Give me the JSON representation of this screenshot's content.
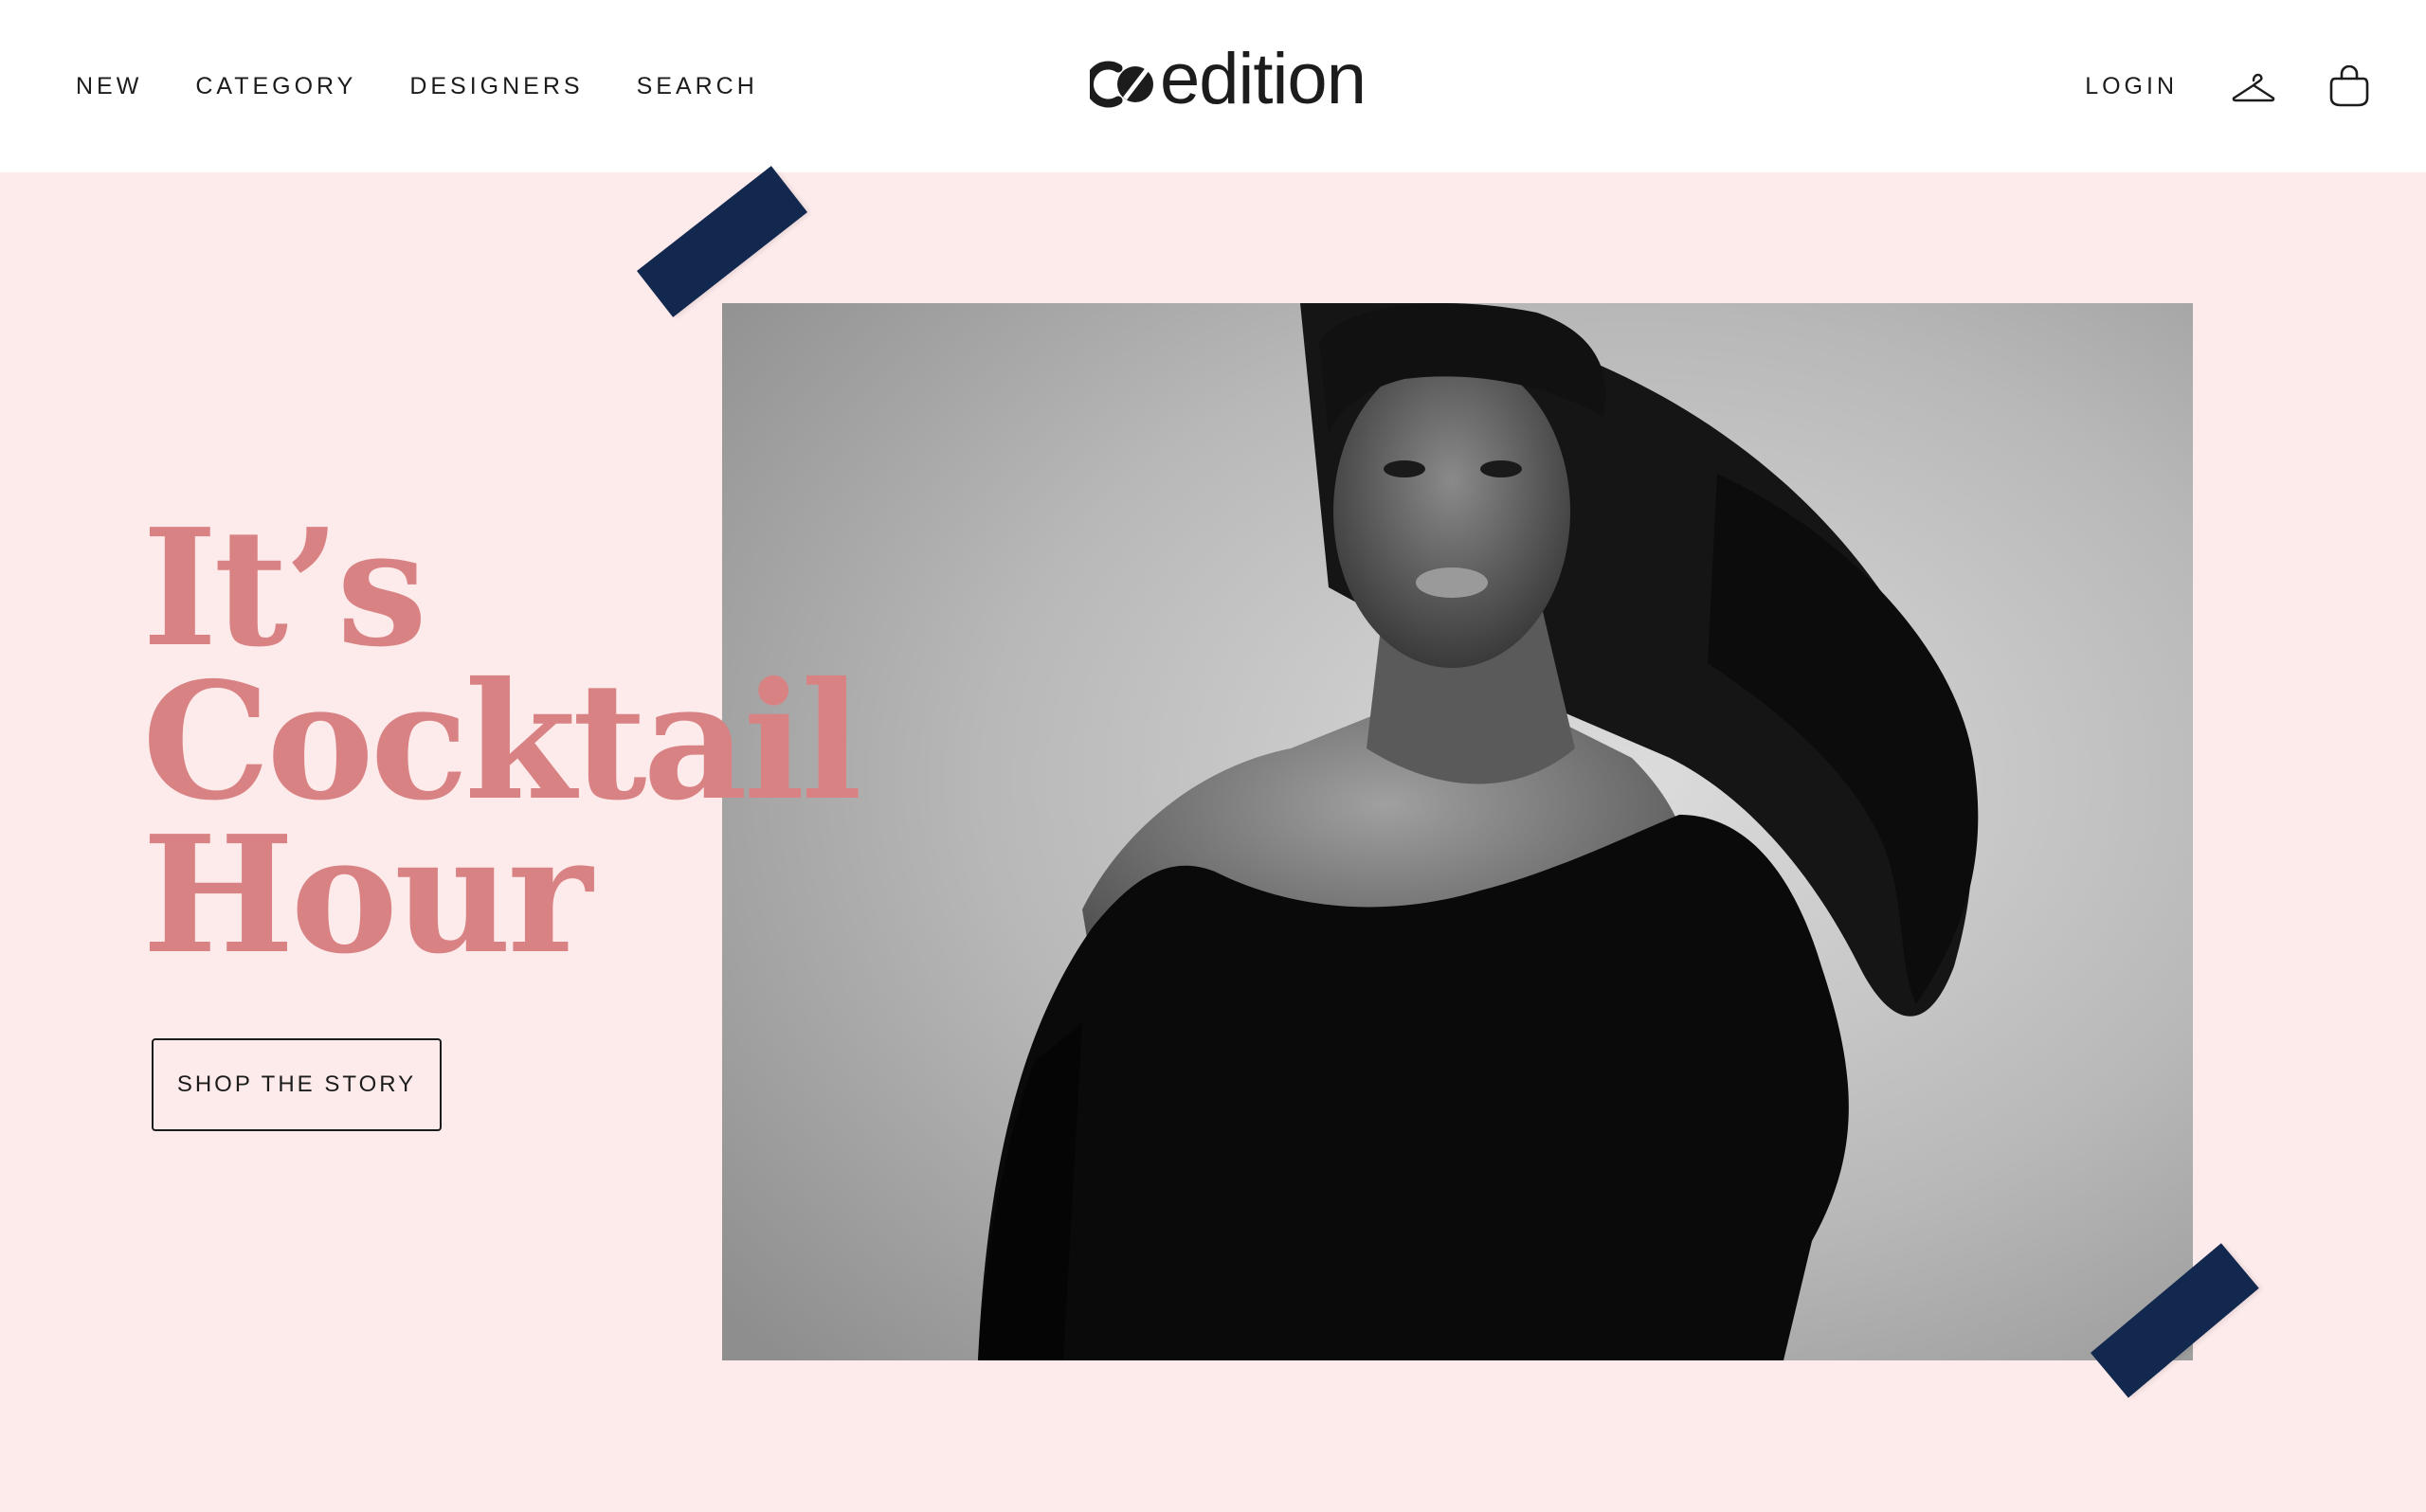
{
  "header": {
    "nav_left": [
      "NEW",
      "CATEGORY",
      "DESIGNERS",
      "SEARCH"
    ],
    "logo_text": "edition",
    "login_label": "LOGIN",
    "icons": [
      "hanger-icon",
      "shopping-bag-icon"
    ]
  },
  "hero": {
    "headline_lines": [
      "It’s",
      "Cocktail",
      "Hour"
    ],
    "cta_label": "SHOP THE STORY",
    "photo_description_icon": "model-photo"
  },
  "colors": {
    "background": "#fdeaea",
    "header_bg": "#ffffff",
    "headline": "#d98283",
    "tape": "#12284f",
    "text": "#1c1c1c"
  }
}
